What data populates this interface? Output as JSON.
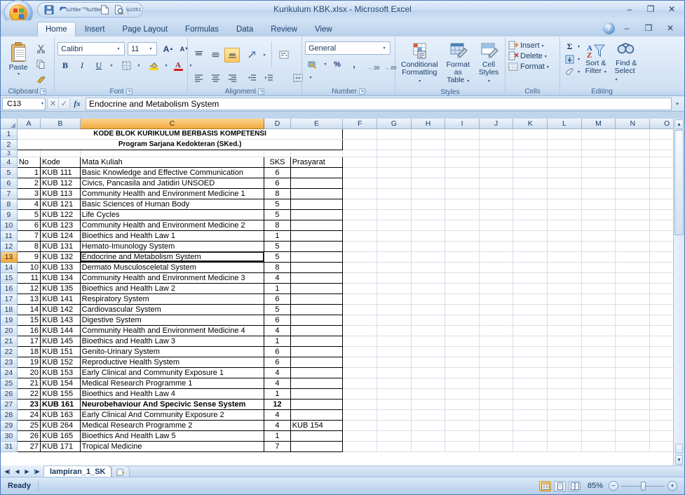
{
  "window": {
    "title": "Kurikulum KBK.xlsx - Microsoft Excel",
    "minimize": "–",
    "restore": "❐",
    "close": "✕"
  },
  "quick_access": {
    "save": "💾",
    "undo": "↶",
    "redo": "↷",
    "new": "🗋",
    "print_preview": "🔍",
    "customize": "▾"
  },
  "ribbon_tabs": [
    {
      "label": "Home",
      "active": true
    },
    {
      "label": "Insert",
      "active": false
    },
    {
      "label": "Page Layout",
      "active": false
    },
    {
      "label": "Formulas",
      "active": false
    },
    {
      "label": "Data",
      "active": false
    },
    {
      "label": "Review",
      "active": false
    },
    {
      "label": "View",
      "active": false
    }
  ],
  "help": {
    "label": "?"
  },
  "ribbon": {
    "clipboard": {
      "group_label": "Clipboard",
      "paste": "Paste",
      "paste_caret": "▾",
      "cut": "✂",
      "copy": "⧉",
      "format_painter": "🖌",
      "dialog_launcher": "↘"
    },
    "font": {
      "group_label": "Font",
      "font_name": "Calibri",
      "font_size": "11",
      "grow_font": "A",
      "shrink_font": "A",
      "bold": "B",
      "italic": "I",
      "underline": "U",
      "borders": "⊞",
      "fill_color": "🪣",
      "font_color": "A",
      "dialog_launcher": "↘"
    },
    "alignment": {
      "group_label": "Alignment",
      "align_top": "≡",
      "align_middle": "≡",
      "align_bottom": "≡",
      "orientation": "↰",
      "align_left": "≡",
      "align_center": "≡",
      "align_right": "≡",
      "decrease_indent": "⇤",
      "increase_indent": "⇥",
      "wrap_text": "⤵",
      "merge_center": "⌷",
      "dialog_launcher": "↘"
    },
    "number": {
      "group_label": "Number",
      "format": "General",
      "accounting": "💵",
      "percent": "%",
      "comma": ",",
      "increase_decimal": ".00",
      "decrease_decimal": ".00",
      "dialog_launcher": "↘"
    },
    "styles": {
      "group_label": "Styles",
      "conditional_formatting": "Conditional\nFormatting",
      "conditional_formatting_l1": "Conditional",
      "conditional_formatting_l2": "Formatting",
      "format_as_table_l1": "Format",
      "format_as_table_l2": "as Table",
      "cell_styles_l1": "Cell",
      "cell_styles_l2": "Styles"
    },
    "cells": {
      "group_label": "Cells",
      "insert": "Insert",
      "delete": "Delete",
      "format": "Format"
    },
    "editing": {
      "group_label": "Editing",
      "autosum": "Σ",
      "fill": "↓",
      "clear": "⬭",
      "sort_filter_l1": "Sort &",
      "sort_filter_l2": "Filter",
      "find_select_l1": "Find &",
      "find_select_l2": "Select",
      "sort_az": "AZ",
      "find_icon": "🔭"
    }
  },
  "formula_bar": {
    "name_box": "C13",
    "name_box_caret": "▾",
    "cancel": "✕",
    "enter": "✓",
    "insert_function": "fx",
    "value": "Endocrine and Metabolism System",
    "expand": "▾"
  },
  "grid": {
    "columns": [
      "A",
      "B",
      "C",
      "D",
      "E",
      "F",
      "G",
      "H",
      "I",
      "J",
      "K",
      "L",
      "M",
      "N",
      "O"
    ],
    "selected_column": "C",
    "selected_row": 13,
    "active_cell": "C13",
    "title_row1": "KODE BLOK KURIKULUM BERBASIS KOMPETENSI",
    "title_row2": "Program Sarjana Kedokteran (SKed.)",
    "headers": {
      "no": "No",
      "kode": "Kode",
      "mata_kuliah": "Mata Kuliah",
      "sks": "SKS",
      "prasyarat": "Prasyarat"
    },
    "rows": [
      {
        "row": 5,
        "no": "1",
        "kode": "KUB 111",
        "mata_kuliah": "Basic Knowledge and Effective Communication",
        "sks": "6",
        "prasyarat": ""
      },
      {
        "row": 6,
        "no": "2",
        "kode": "KUB 112",
        "mata_kuliah": "Civics, Pancasila and Jatidiri UNSOED",
        "sks": "6",
        "prasyarat": ""
      },
      {
        "row": 7,
        "no": "3",
        "kode": "KUB 113",
        "mata_kuliah": "Community Health and Environment Medicine 1",
        "sks": "8",
        "prasyarat": ""
      },
      {
        "row": 8,
        "no": "4",
        "kode": "KUB 121",
        "mata_kuliah": "Basic Sciences of Human Body",
        "sks": "5",
        "prasyarat": ""
      },
      {
        "row": 9,
        "no": "5",
        "kode": "KUB 122",
        "mata_kuliah": "Life Cycles",
        "sks": "5",
        "prasyarat": ""
      },
      {
        "row": 10,
        "no": "6",
        "kode": "KUB 123",
        "mata_kuliah": "Community Health and Environment Medicine 2",
        "sks": "8",
        "prasyarat": ""
      },
      {
        "row": 11,
        "no": "7",
        "kode": "KUB 124",
        "mata_kuliah": "Bioethics and Health Law 1",
        "sks": "1",
        "prasyarat": ""
      },
      {
        "row": 12,
        "no": "8",
        "kode": "KUB 131",
        "mata_kuliah": "Hemato-Imunology System",
        "sks": "5",
        "prasyarat": ""
      },
      {
        "row": 13,
        "no": "9",
        "kode": "KUB 132",
        "mata_kuliah": "Endocrine and Metabolism System",
        "sks": "5",
        "prasyarat": "",
        "active": true
      },
      {
        "row": 14,
        "no": "10",
        "kode": "KUB 133",
        "mata_kuliah": "Dermato Musculosceletal System",
        "sks": "8",
        "prasyarat": ""
      },
      {
        "row": 15,
        "no": "11",
        "kode": "KUB 134",
        "mata_kuliah": "Community Health and Environment Medicine 3",
        "sks": "4",
        "prasyarat": ""
      },
      {
        "row": 16,
        "no": "12",
        "kode": "KUB 135",
        "mata_kuliah": "Bioethics and Health Law  2",
        "sks": "1",
        "prasyarat": ""
      },
      {
        "row": 17,
        "no": "13",
        "kode": "KUB 141",
        "mata_kuliah": "Respiratory System",
        "sks": "6",
        "prasyarat": ""
      },
      {
        "row": 18,
        "no": "14",
        "kode": "KUB 142",
        "mata_kuliah": "Cardiovascular System",
        "sks": "5",
        "prasyarat": ""
      },
      {
        "row": 19,
        "no": "15",
        "kode": "KUB 143",
        "mata_kuliah": "Digestive System",
        "sks": "6",
        "prasyarat": ""
      },
      {
        "row": 20,
        "no": "16",
        "kode": "KUB 144",
        "mata_kuliah": "Community Health and Environment Medicine 4",
        "sks": "4",
        "prasyarat": ""
      },
      {
        "row": 21,
        "no": "17",
        "kode": "KUB 145",
        "mata_kuliah": "Bioethics and Health Law  3",
        "sks": "1",
        "prasyarat": ""
      },
      {
        "row": 22,
        "no": "18",
        "kode": "KUB 151",
        "mata_kuliah": "Genito-Urinary System",
        "sks": "6",
        "prasyarat": ""
      },
      {
        "row": 23,
        "no": "19",
        "kode": "KUB 152",
        "mata_kuliah": "Reproductive Health System",
        "sks": "6",
        "prasyarat": ""
      },
      {
        "row": 24,
        "no": "20",
        "kode": "KUB 153",
        "mata_kuliah": "Early Clinical and Community Exposure 1",
        "sks": "4",
        "prasyarat": ""
      },
      {
        "row": 25,
        "no": "21",
        "kode": "KUB 154",
        "mata_kuliah": "Medical Research Programme 1",
        "sks": "4",
        "prasyarat": ""
      },
      {
        "row": 26,
        "no": "22",
        "kode": "KUB 155",
        "mata_kuliah": "Bioethics and Health Law  4",
        "sks": "1",
        "prasyarat": ""
      },
      {
        "row": 27,
        "no": "23",
        "kode": "KUB 161",
        "mata_kuliah": "Neurobehaviour And Specivic Sense System",
        "sks": "12",
        "prasyarat": "",
        "bold": true
      },
      {
        "row": 28,
        "no": "24",
        "kode": "KUB 163",
        "mata_kuliah": "Early Clinical And Community Exposure 2",
        "sks": "4",
        "prasyarat": ""
      },
      {
        "row": 29,
        "no": "25",
        "kode": "KUB 264",
        "mata_kuliah": "Medical Research Programme 2",
        "sks": "4",
        "prasyarat": "KUB 154"
      },
      {
        "row": 30,
        "no": "26",
        "kode": "KUB 165",
        "mata_kuliah": "Bioethics And Health Law 5",
        "sks": "1",
        "prasyarat": ""
      },
      {
        "row": 31,
        "no": "27",
        "kode": "KUB 171",
        "mata_kuliah": "Tropical Medicine",
        "sks": "7",
        "prasyarat": ""
      }
    ]
  },
  "sheet_tabs": {
    "first": "⏮",
    "prev": "◀",
    "next": "▶",
    "last": "⏭",
    "sheets": [
      {
        "name": "lampiran_1_SK",
        "active": true
      }
    ],
    "new_sheet": "🗋"
  },
  "status_bar": {
    "status": "Ready",
    "view_normal": "▦",
    "view_layout": "▣",
    "view_pagebreak": "▤",
    "zoom": "85%",
    "zoom_out": "−",
    "zoom_in": "+"
  },
  "colors": {
    "accent": "#c0398a",
    "selection": "#f3a93f",
    "bold_row": "#7b1d1d"
  }
}
